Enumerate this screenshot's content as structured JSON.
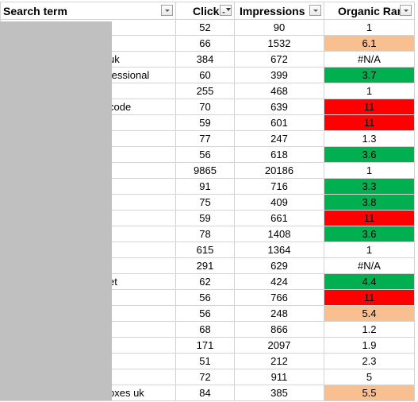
{
  "headers": {
    "term": "Search term",
    "clicks": "Clicks",
    "impressions": "Impressions",
    "rank": "Organic Rank"
  },
  "filters": {
    "term": "dropdown",
    "clicks": "filter-active",
    "impressions": "dropdown",
    "rank": "dropdown"
  },
  "colors": {
    "orange": "#f8bf90",
    "green": "#00b050",
    "red": "#ff0000",
    "grid": "#d4d4d4",
    "redaction": "#c0c0c0"
  },
  "rows": [
    {
      "term": "",
      "clicks": "52",
      "impressions": "90",
      "rank": "1",
      "fill": ""
    },
    {
      "term": "",
      "clicks": "66",
      "impressions": "1532",
      "rank": "6.1",
      "fill": "orange"
    },
    {
      "term": "uk",
      "clicks": "384",
      "impressions": "672",
      "rank": "#N/A",
      "fill": ""
    },
    {
      "term": "fessional",
      "clicks": "60",
      "impressions": "399",
      "rank": "3.7",
      "fill": "green"
    },
    {
      "term": "",
      "clicks": "255",
      "impressions": "468",
      "rank": "1",
      "fill": ""
    },
    {
      "term": "code",
      "clicks": "70",
      "impressions": "639",
      "rank": "11",
      "fill": "red"
    },
    {
      "term": "",
      "clicks": "59",
      "impressions": "601",
      "rank": "11",
      "fill": "red"
    },
    {
      "term": "",
      "clicks": "77",
      "impressions": "247",
      "rank": "1.3",
      "fill": ""
    },
    {
      "term": "",
      "clicks": "56",
      "impressions": "618",
      "rank": "3.6",
      "fill": "green"
    },
    {
      "term": "",
      "clicks": "9865",
      "impressions": "20186",
      "rank": "1",
      "fill": ""
    },
    {
      "term": "",
      "clicks": "91",
      "impressions": "716",
      "rank": "3.3",
      "fill": "green"
    },
    {
      "term": "",
      "clicks": "75",
      "impressions": "409",
      "rank": "3.8",
      "fill": "green"
    },
    {
      "term": "",
      "clicks": "59",
      "impressions": "661",
      "rank": "11",
      "fill": "red"
    },
    {
      "term": "",
      "clicks": "78",
      "impressions": "1408",
      "rank": "3.6",
      "fill": "green"
    },
    {
      "term": "",
      "clicks": "615",
      "impressions": "1364",
      "rank": "1",
      "fill": ""
    },
    {
      "term": "",
      "clicks": "291",
      "impressions": "629",
      "rank": "#N/A",
      "fill": ""
    },
    {
      "term": "et",
      "clicks": "62",
      "impressions": "424",
      "rank": "4.4",
      "fill": "green"
    },
    {
      "term": "",
      "clicks": "56",
      "impressions": "766",
      "rank": "11",
      "fill": "red"
    },
    {
      "term": "",
      "clicks": "56",
      "impressions": "248",
      "rank": "5.4",
      "fill": "orange"
    },
    {
      "term": "",
      "clicks": "68",
      "impressions": "866",
      "rank": "1.2",
      "fill": ""
    },
    {
      "term": "",
      "clicks": "171",
      "impressions": "2097",
      "rank": "1.9",
      "fill": ""
    },
    {
      "term": "",
      "clicks": "51",
      "impressions": "212",
      "rank": "2.3",
      "fill": ""
    },
    {
      "term": "",
      "clicks": "72",
      "impressions": "911",
      "rank": "5",
      "fill": ""
    },
    {
      "term": "oxes uk",
      "clicks": "84",
      "impressions": "385",
      "rank": "5.5",
      "fill": "orange"
    }
  ]
}
